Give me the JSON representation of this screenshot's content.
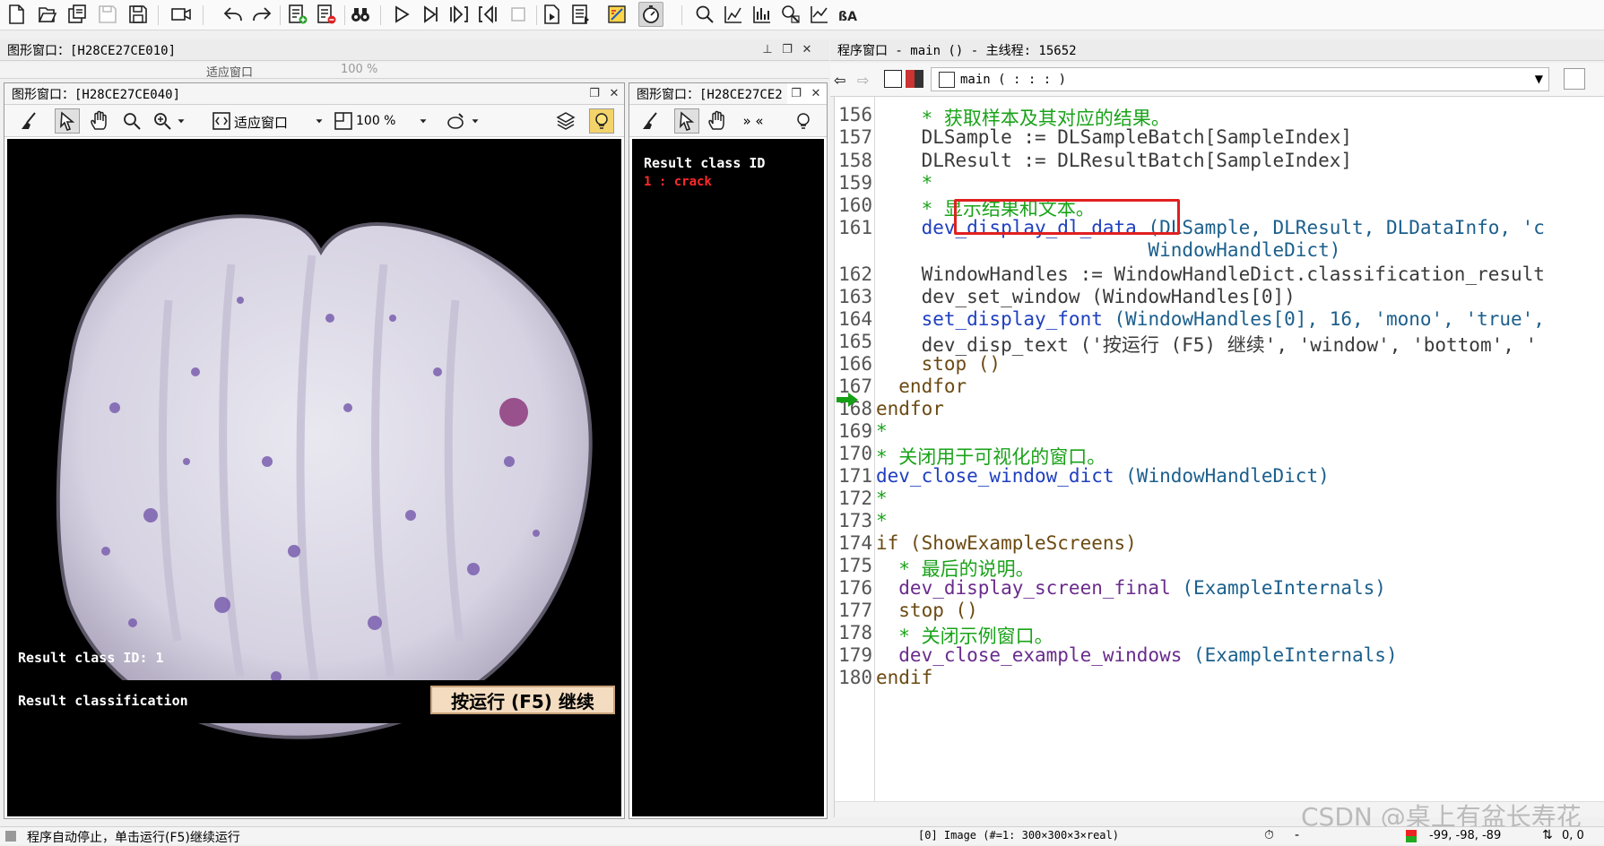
{
  "toolbar": {
    "icons": [
      "new-file-icon",
      "open-file-icon",
      "open-example-icon",
      "save-disabled-icon",
      "save-all-icon",
      "record-icon",
      "undo-icon",
      "redo-icon",
      "insert-proc-icon",
      "delete-proc-icon",
      "binoculars-icon",
      "run-icon",
      "step-over-icon",
      "step-into-icon",
      "step-out-icon",
      "stop-icon",
      "reset-icon",
      "tile-windows-icon",
      "settings-window-icon",
      "profiler-icon",
      "zoom-icon",
      "histogram-icon",
      "line-profile-icon",
      "feature-inspect-icon",
      "gray-profile-icon",
      "ocr-assistant-icon"
    ]
  },
  "graphics_main": {
    "title": "图形窗口：[H28CE27CE010]",
    "zoom": "100 %",
    "fit": "适应窗口"
  },
  "graphics_win1": {
    "title": "图形窗口：[H28CE27CE040]",
    "fit_label": "适应窗口",
    "zoom_label": "100 %",
    "overlay_class_id": "Result class ID: 1",
    "overlay_classification": "Result classification",
    "continue_button": "按运行 (F5) 继续"
  },
  "graphics_win2": {
    "title": "图形窗口：[H28CE27CE2",
    "header": "Result class ID",
    "result_line": "1 : crack"
  },
  "program_window": {
    "title": "程序窗口 - main () - 主线程: 15652",
    "proc_selector": "main ( : : : )"
  },
  "code_lines": [
    {
      "num": "156",
      "parts": [
        {
          "t": "    * 获取样本及其对应的结果。",
          "c": "c-cm"
        }
      ]
    },
    {
      "num": "157",
      "parts": [
        {
          "t": "    DLSample := DLSampleBatch[SampleIndex]",
          "c": "c-op"
        }
      ]
    },
    {
      "num": "158",
      "parts": [
        {
          "t": "    DLResult := DLResultBatch[SampleIndex]",
          "c": "c-op"
        }
      ]
    },
    {
      "num": "159",
      "parts": [
        {
          "t": "    *",
          "c": "c-cm"
        }
      ]
    },
    {
      "num": "160",
      "parts": [
        {
          "t": "    * 显示结果和文本。",
          "c": "c-cm"
        }
      ]
    },
    {
      "num": "161",
      "parts": [
        {
          "t": "    dev_display_dl_data ",
          "c": "c-bl"
        },
        {
          "t": "(DLSample, DLResult, DLDataInfo, 'c",
          "c": "c-pa"
        }
      ]
    },
    {
      "num": "",
      "parts": [
        {
          "t": "                        WindowHandleDict)",
          "c": "c-pa"
        }
      ]
    },
    {
      "num": "162",
      "parts": [
        {
          "t": "    WindowHandles := WindowHandleDict.classification_result",
          "c": "c-op"
        }
      ]
    },
    {
      "num": "163",
      "parts": [
        {
          "t": "    dev_set_window (WindowHandles[0])",
          "c": "c-op"
        }
      ]
    },
    {
      "num": "164",
      "parts": [
        {
          "t": "    set_display_font ",
          "c": "c-bl"
        },
        {
          "t": "(WindowHandles[0], 16, 'mono', 'true',",
          "c": "c-pa"
        }
      ]
    },
    {
      "num": "165",
      "parts": [
        {
          "t": "    dev_disp_text ('按运行 (F5) 继续', 'window', 'bottom', '",
          "c": "c-op"
        }
      ]
    },
    {
      "num": "166",
      "parts": [
        {
          "t": "    stop ()",
          "c": "c-kw"
        }
      ]
    },
    {
      "num": "167",
      "parts": [
        {
          "t": "  endfor",
          "c": "c-kw"
        }
      ]
    },
    {
      "num": "168",
      "parts": [
        {
          "t": "endfor",
          "c": "c-kw"
        }
      ]
    },
    {
      "num": "169",
      "parts": [
        {
          "t": "*",
          "c": "c-cm"
        }
      ]
    },
    {
      "num": "170",
      "parts": [
        {
          "t": "* 关闭用于可视化的窗口。",
          "c": "c-cm"
        }
      ]
    },
    {
      "num": "171",
      "parts": [
        {
          "t": "dev_close_window_dict ",
          "c": "c-bl"
        },
        {
          "t": "(WindowHandleDict)",
          "c": "c-pa"
        }
      ]
    },
    {
      "num": "172",
      "parts": [
        {
          "t": "*",
          "c": "c-cm"
        }
      ]
    },
    {
      "num": "173",
      "parts": [
        {
          "t": "*",
          "c": "c-cm"
        }
      ]
    },
    {
      "num": "174",
      "parts": [
        {
          "t": "if (ShowExampleScreens)",
          "c": "c-kw"
        }
      ]
    },
    {
      "num": "175",
      "parts": [
        {
          "t": "  * 最后的说明。",
          "c": "c-cm"
        }
      ]
    },
    {
      "num": "176",
      "parts": [
        {
          "t": "  dev_display_screen_final ",
          "c": "c-pu"
        },
        {
          "t": "(ExampleInternals)",
          "c": "c-pa"
        }
      ]
    },
    {
      "num": "177",
      "parts": [
        {
          "t": "  stop ()",
          "c": "c-kw"
        }
      ]
    },
    {
      "num": "178",
      "parts": [
        {
          "t": "  * 关闭示例窗口。",
          "c": "c-cm"
        }
      ]
    },
    {
      "num": "179",
      "parts": [
        {
          "t": "  dev_close_example_windows ",
          "c": "c-pu"
        },
        {
          "t": "(ExampleInternals)",
          "c": "c-pa"
        }
      ]
    },
    {
      "num": "180",
      "parts": [
        {
          "t": "endif",
          "c": "c-kw"
        }
      ]
    }
  ],
  "status": {
    "left": "程序自动停止，单击运行(F5)继续运行",
    "image_info": "[0] Image (#=1: 300×300×3×real)",
    "coords": "-99, -98, -89",
    "right_vals": "0, 0"
  },
  "watermark": "CSDN @桌上有盆长寿花",
  "colors": {
    "highlight_box": "#e02020",
    "result_red": "#ff2a2a",
    "pc_arrow": "#16a016"
  }
}
